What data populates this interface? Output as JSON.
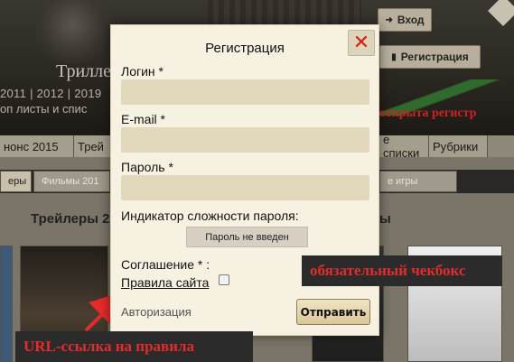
{
  "background": {
    "header_text": "Триллер",
    "years_line": "2011 | 2012 | 2019",
    "tops_line": "оп листы и спис",
    "login_button": "Вход",
    "register_button": "Регистрация",
    "banner": "открыта регистр",
    "nav": [
      "нонс 2015",
      "Трей",
      "е списки",
      "Рубрики"
    ],
    "tabs": [
      "еры",
      "Фильмы 201",
      "е игры"
    ],
    "section_left": "Трейлеры 2",
    "section_right": "ы"
  },
  "modal": {
    "title": "Регистрация",
    "login_label": "Логин *",
    "email_label": "E-mail *",
    "password_label": "Пароль *",
    "strength_label": "Индикатор сложности пароля:",
    "strength_value": "Пароль не введен",
    "agreement_label": "Соглашение * :",
    "rules_link": "Правила сайта",
    "auth_link": "Авторизация",
    "submit": "Отправить",
    "close_icon": "close-x-icon",
    "accent_color": "#d81e10"
  },
  "annotations": {
    "checkbox_note": "обязательный чекбокс",
    "url_note": "URL-ссылка на правила",
    "color": "#e52b2b"
  }
}
